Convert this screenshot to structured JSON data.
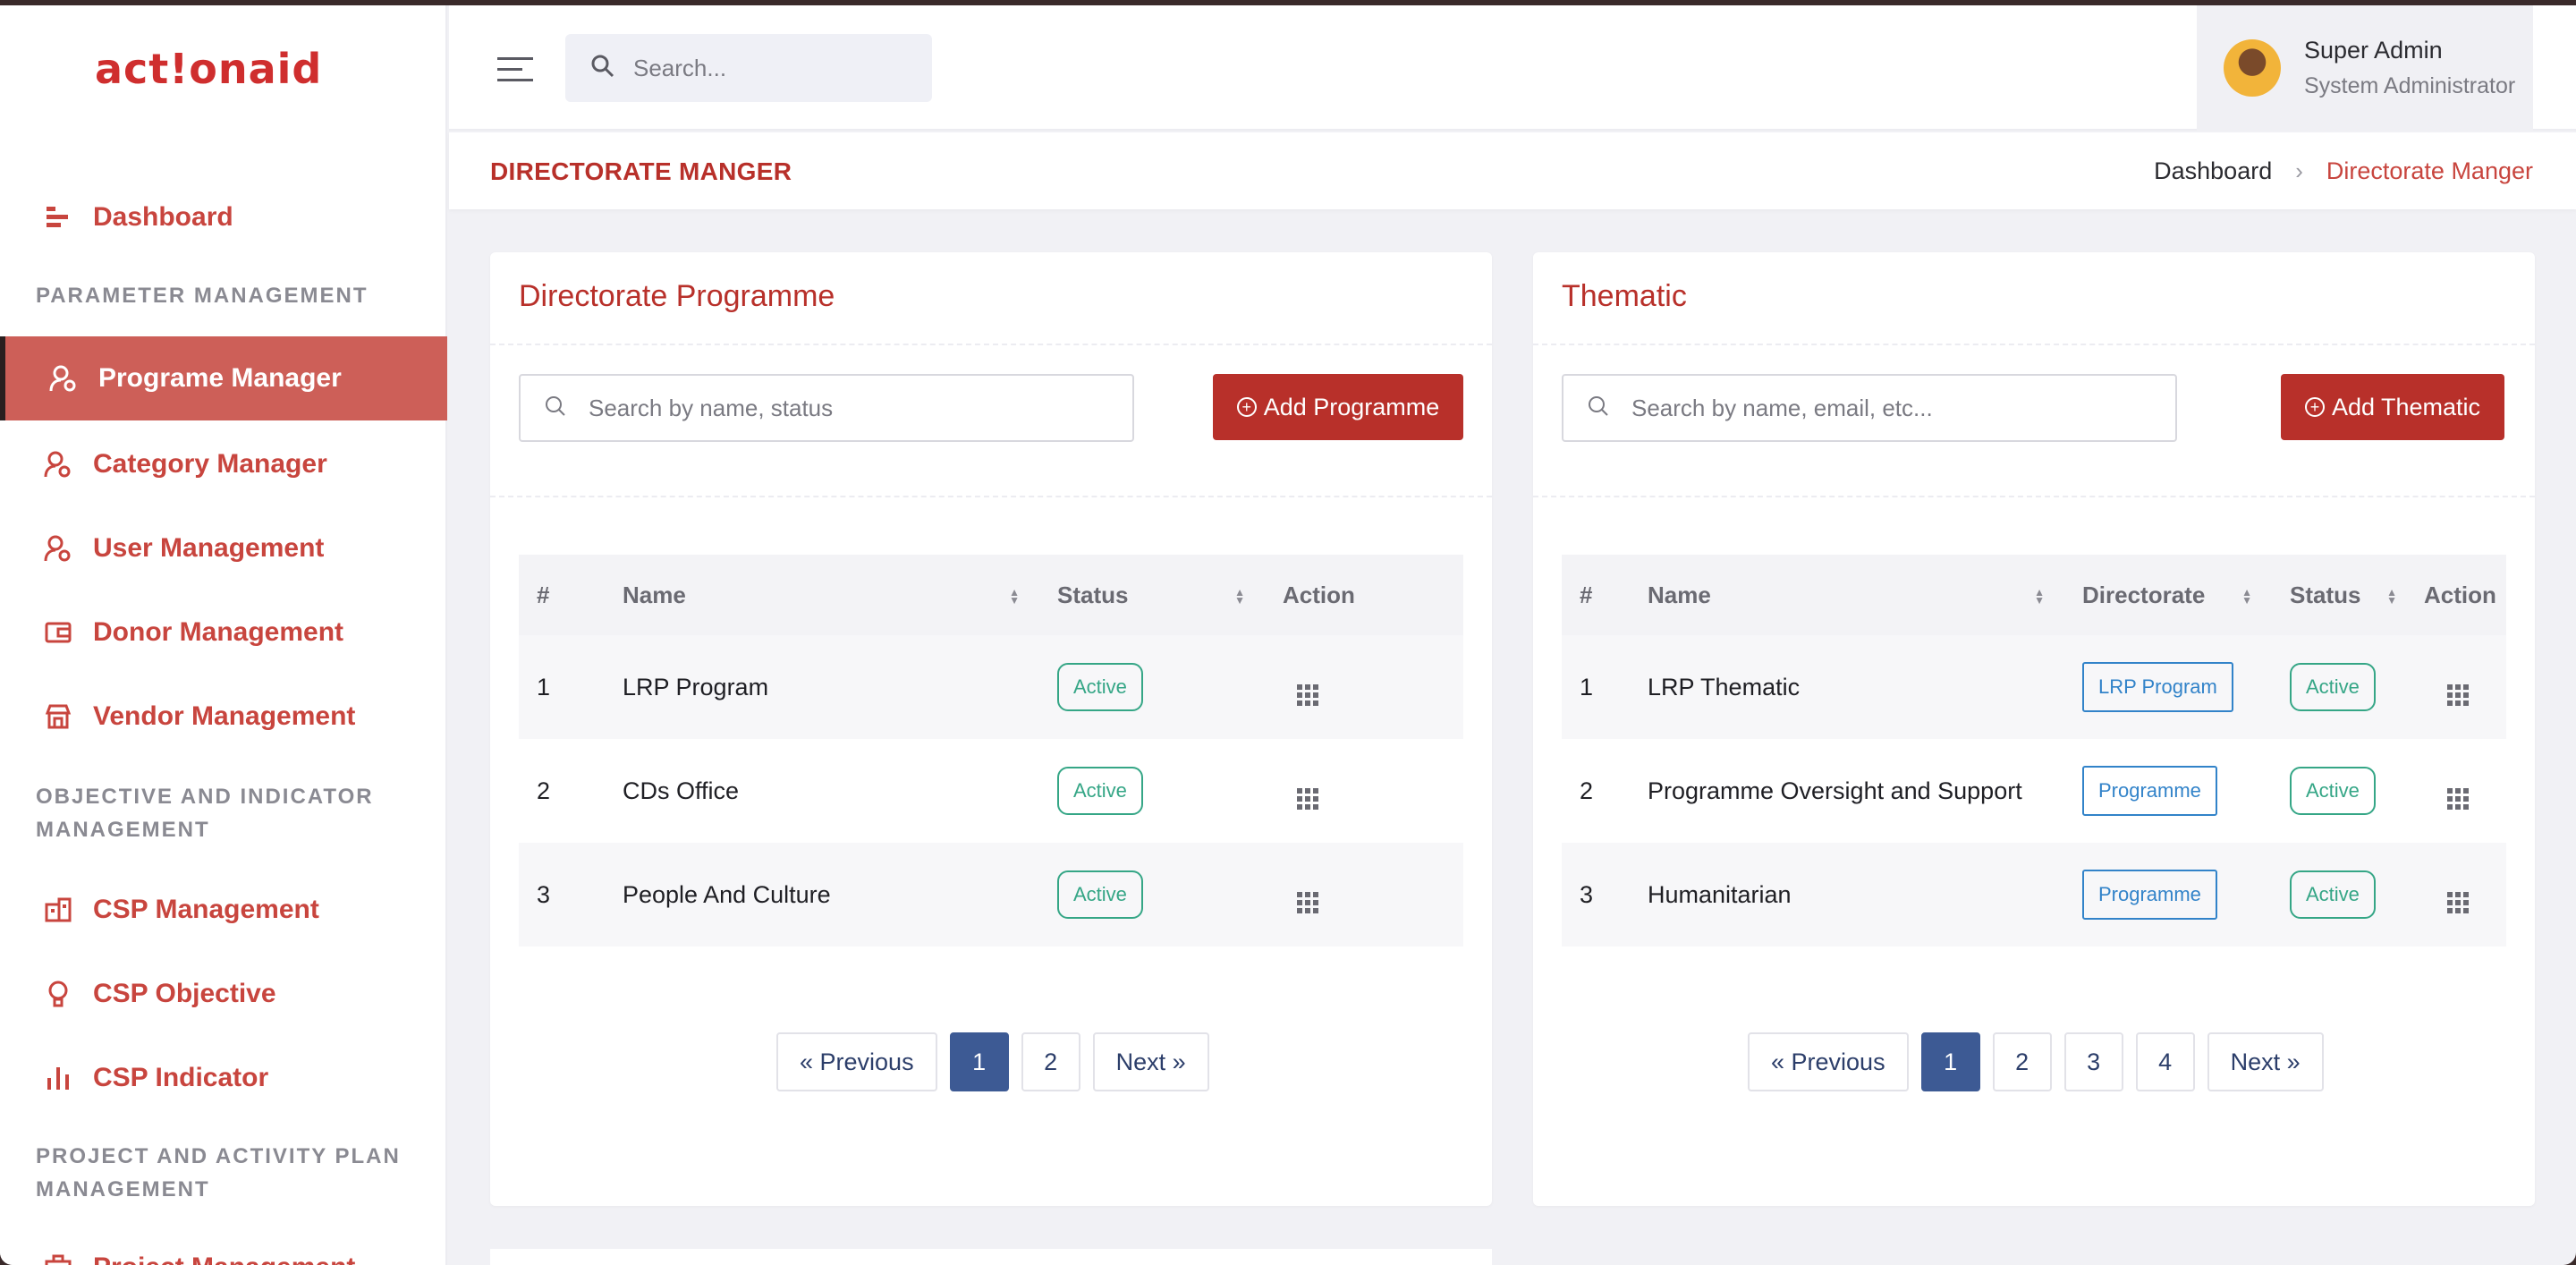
{
  "brand": {
    "logo": "act!onaid",
    "accent": "#b8302a"
  },
  "sidebar": {
    "dashboard": "Dashboard",
    "section_parameter": "PARAMETER MANAGEMENT",
    "items_parameter": [
      "Programe Manager",
      "Category Manager",
      "User Management",
      "Donor Management",
      "Vendor Management"
    ],
    "section_objective": "OBJECTIVE AND INDICATOR MANAGEMENT",
    "items_objective": [
      "CSP Management",
      "CSP Objective",
      "CSP Indicator"
    ],
    "section_project": "PROJECT AND ACTIVITY PLAN MANAGEMENT",
    "items_project": [
      "Project Management"
    ]
  },
  "topbar": {
    "search_placeholder": "Search...",
    "user_name": "Super Admin",
    "user_role": "System Administrator"
  },
  "page": {
    "title": "DIRECTORATE MANGER",
    "breadcrumb_home": "Dashboard",
    "breadcrumb_current": "Directorate Manger"
  },
  "programme": {
    "title": "Directorate Programme",
    "search_placeholder": "Search by name, status",
    "add_label": "Add Programme",
    "columns": [
      "#",
      "Name",
      "Status",
      "Action"
    ],
    "rows": [
      {
        "num": "1",
        "name": "LRP Program",
        "status": "Active"
      },
      {
        "num": "2",
        "name": "CDs Office",
        "status": "Active"
      },
      {
        "num": "3",
        "name": "People And Culture",
        "status": "Active"
      }
    ],
    "pagination": {
      "prev": "« Previous",
      "pages": [
        "1",
        "2"
      ],
      "next": "Next »",
      "current": "1"
    }
  },
  "thematic": {
    "title": "Thematic",
    "search_placeholder": "Search by name, email, etc...",
    "add_label": "Add Thematic",
    "columns": [
      "#",
      "Name",
      "Directorate",
      "Status",
      "Action"
    ],
    "rows": [
      {
        "num": "1",
        "name": "LRP Thematic",
        "directorate": "LRP Program",
        "status": "Active"
      },
      {
        "num": "2",
        "name": "Programme Oversight and Support",
        "directorate": "Programme",
        "status": "Active"
      },
      {
        "num": "3",
        "name": "Humanitarian",
        "directorate": "Programme",
        "status": "Active"
      }
    ],
    "pagination": {
      "prev": "« Previous",
      "pages": [
        "1",
        "2",
        "3",
        "4"
      ],
      "next": "Next »",
      "current": "1"
    }
  }
}
